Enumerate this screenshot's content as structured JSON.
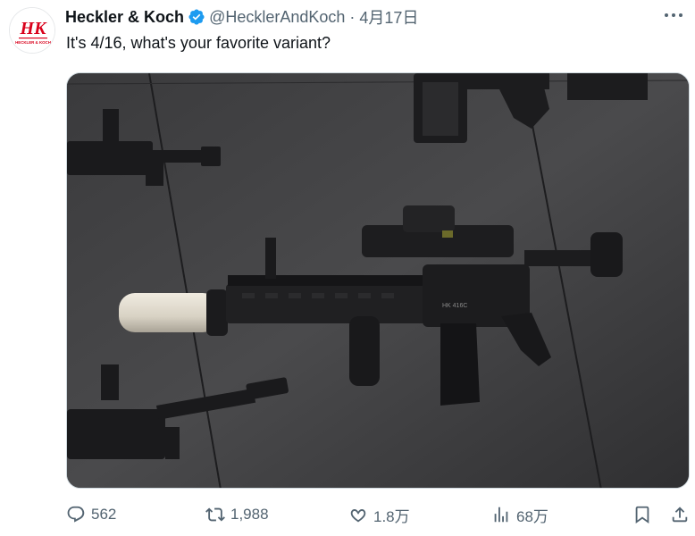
{
  "author": {
    "name": "Heckler & Koch",
    "handle": "@HecklerAndKoch",
    "separator": "·",
    "date": "4月17日",
    "logo_text": "HK",
    "logo_subtext": "HECKLER & KOCH",
    "verified_color": "#1d9bf0",
    "brand_color": "#d9001b"
  },
  "tweet": {
    "text": "It's 4/16, what's your favorite variant?"
  },
  "media": {
    "icon": "rifle-display-photo",
    "engraving": "HK 416C"
  },
  "actions": {
    "reply_count": "562",
    "retweet_count": "1,988",
    "like_count": "1.8万",
    "view_count": "68万"
  },
  "colors": {
    "text_primary": "#0f1419",
    "text_secondary": "#536471",
    "border": "#cfd9de"
  }
}
